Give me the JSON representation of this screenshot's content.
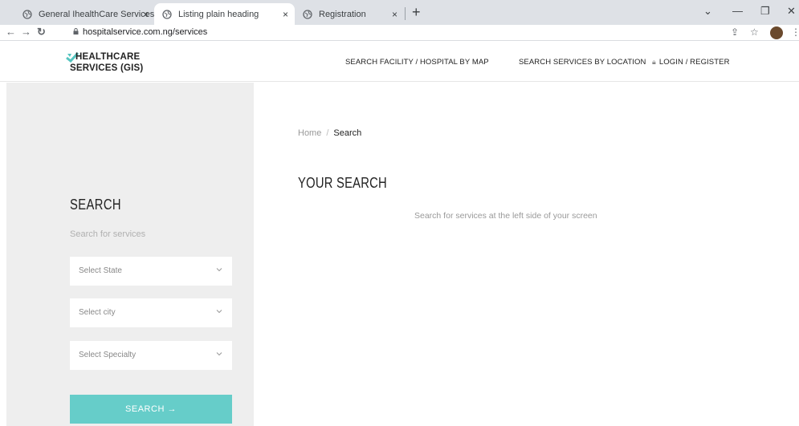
{
  "browser": {
    "tabs": [
      {
        "title": "General IhealthCare Services",
        "active": false
      },
      {
        "title": "Listing plain heading",
        "active": true
      },
      {
        "title": "Registration",
        "active": false
      }
    ],
    "new_tab": "+",
    "close_glyph": "×",
    "url": "hospitalservice.com.ng/services"
  },
  "site": {
    "logo_line1": "HEALTHCARE",
    "logo_line2": "SERVICES (GIS)",
    "nav": {
      "map": "SEARCH FACILITY / HOSPITAL BY MAP",
      "location": "SEARCH SERVICES BY LOCATION",
      "login": "LOGIN / REGISTER"
    }
  },
  "sidebar": {
    "title": "SEARCH",
    "subtitle": "Search for services",
    "selects": [
      {
        "placeholder": "Select State"
      },
      {
        "placeholder": "Select city"
      },
      {
        "placeholder": "Select Specialty"
      }
    ],
    "button": "SEARCH  →"
  },
  "main": {
    "breadcrumb": {
      "home": "Home",
      "separator": "/",
      "current": "Search"
    },
    "title": "YOUR SEARCH",
    "message": "Search for services at the left side of your screen"
  },
  "colors": {
    "accent": "#66cdc9",
    "sidebar_bg": "#eeeeee"
  }
}
